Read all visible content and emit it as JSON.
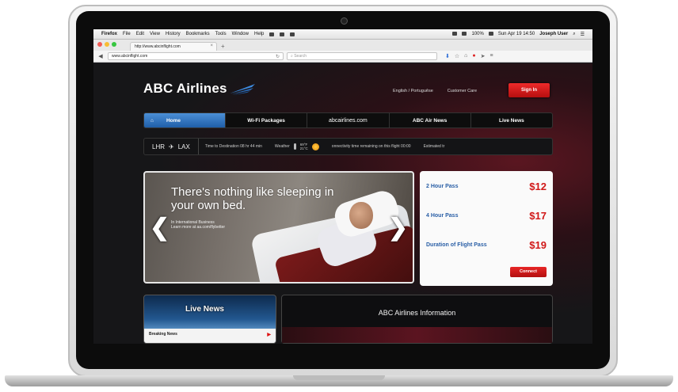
{
  "menubar": {
    "app_name": "Firefox",
    "menus": [
      "File",
      "Edit",
      "View",
      "History",
      "Bookmarks",
      "Tools",
      "Window",
      "Help"
    ],
    "battery": "100%",
    "datetime": "Sun Apr 19  14:50",
    "user": "Joseph User"
  },
  "browser": {
    "tab_title": "http://www.abcinflight.com",
    "url": "www.abcinflight.com",
    "search_placeholder": "Search"
  },
  "site": {
    "brand": "ABC Airlines",
    "language": "English / Portuguêse",
    "customer_care": "Customer Care",
    "sign_in": "Sign In",
    "nav": [
      "Home",
      "Wi-Fi Packages",
      "abcairlines.com",
      "ABC Air News",
      "Live News"
    ],
    "route_from": "LHR",
    "route_to": "LAX",
    "time_to_destination": "Time to Destination  08  hr  44  min",
    "weather_label": "Weather",
    "temp_f": "69°F",
    "temp_c": "21°C",
    "connectivity": "onnectivity time remaining on this flight 00:00",
    "estimated": "Estimated tr"
  },
  "hero": {
    "headline": "There's nothing like sleeping in your own bed.",
    "sub_line1": "In International Business",
    "sub_line2": "Learn more at aa.com/flybetter"
  },
  "passes": [
    {
      "name": "2 Hour Pass",
      "price": "$12"
    },
    {
      "name": "4 Hour Pass",
      "price": "$17"
    },
    {
      "name": "Duration of Flight Pass",
      "price": "$19"
    }
  ],
  "connect_label": "Connect",
  "live_news": {
    "title": "Live News",
    "item": "Breaking News"
  },
  "airline_info_title": "ABC Airlines Information"
}
